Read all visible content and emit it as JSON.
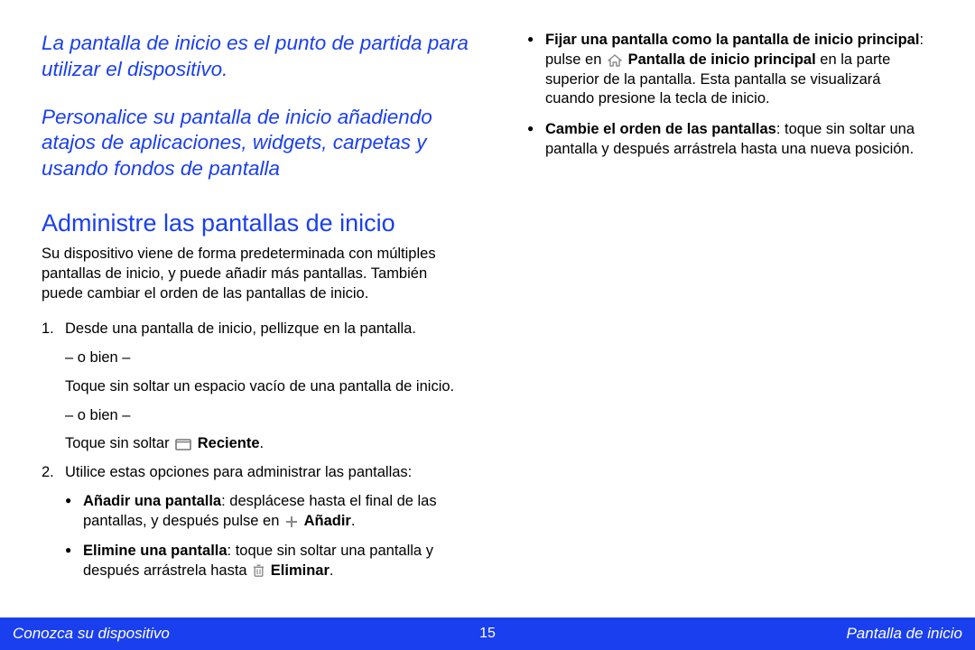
{
  "intro": {
    "line1": "La pantalla de inicio es el punto de partida para utilizar el dispositivo.",
    "line2": "Personalice su pantalla de inicio añadiendo atajos de aplicaciones, widgets, carpetas y usando fondos de pantalla"
  },
  "heading": "Administre las pantallas de inicio",
  "para_default": "Su dispositivo viene de forma predeterminada con múltiples pantallas de inicio, y puede añadir más pantallas. También puede cambiar el orden de las pantallas de inicio.",
  "steps": {
    "step1_lead": "1.",
    "step1_text": "Desde una pantalla de inicio, pellizque en la pantalla.",
    "or_a": "– o bien –",
    "step1_alt1": "Toque sin soltar un espacio vacío de una pantalla de inicio.",
    "or_b": "– o bien –",
    "step1_alt2_prefix": "Toque sin soltar ",
    "step1_alt2_bold": "Reciente",
    "step1_alt2_suffix": ".",
    "step2_lead": "2.",
    "step2_text": "Utilice estas opciones para administrar las pantallas:"
  },
  "bullets": {
    "b1_bold": "Añadir una pantalla",
    "b1_text_a": ": desplácese hasta el final de las pantallas, y después pulse en ",
    "b1_add_word": "Añadir",
    "b1_text_b": ".",
    "b2_bold": "Elimine una pantalla",
    "b2_text_a": ": toque sin soltar una pantalla y después arrástrela hasta ",
    "b2_del_word": "Eliminar",
    "b2_text_b": ".",
    "b3_line1_bold": "Fijar una pantalla como la pantalla de inicio principal",
    "b3_line1_rest": ": pulse en ",
    "b3_home_label": "Pantalla de inicio principal",
    "b3_line2": " en la parte superior de la pantalla. Esta pantalla se visualizará cuando presione la tecla de inicio.",
    "b4_bold": "Cambie el orden de las pantallas",
    "b4_text": ": toque sin soltar una pantalla y después arrástrela hasta una nueva posición."
  },
  "footer": {
    "left": "Conozca su dispositivo",
    "page": "15",
    "right": "Pantalla de inicio"
  }
}
